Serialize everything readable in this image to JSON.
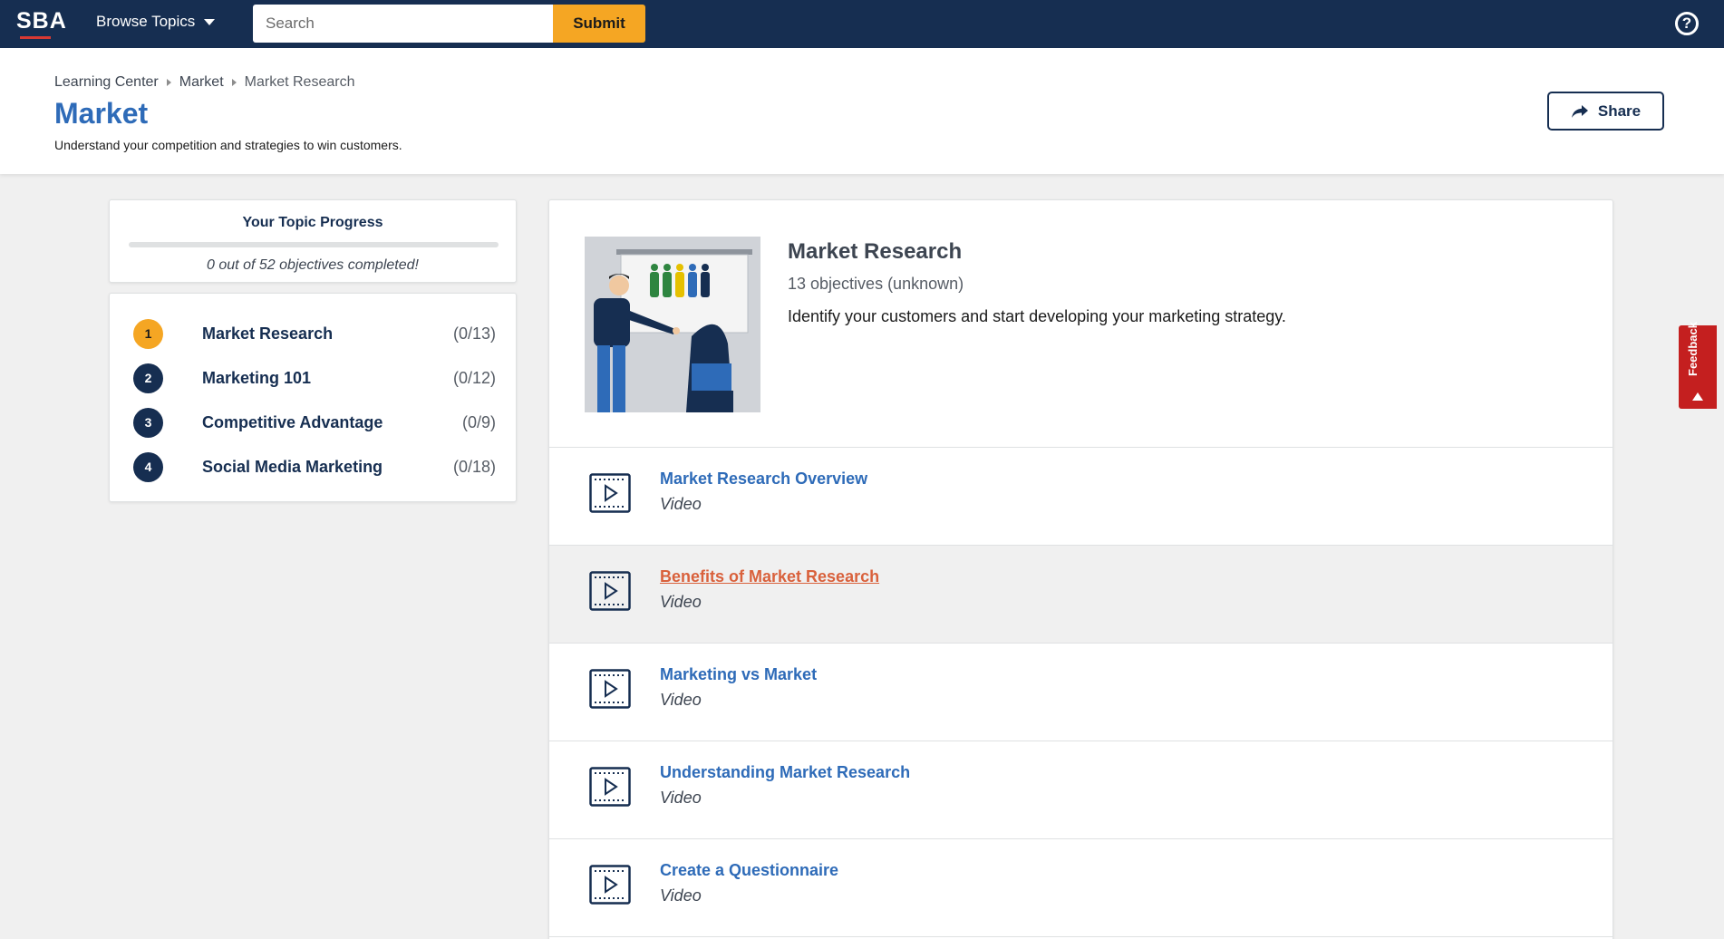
{
  "nav": {
    "logo_text": "SBA",
    "browse_label": "Browse Topics",
    "search_placeholder": "Search",
    "submit_label": "Submit",
    "help_icon_text": "?"
  },
  "breadcrumb": [
    "Learning Center",
    "Market",
    "Market Research"
  ],
  "header": {
    "title": "Market",
    "subtitle": "Understand your competition and strategies to win customers.",
    "share_label": "Share"
  },
  "progress": {
    "title": "Your Topic Progress",
    "text": "0 out of 52 objectives completed!",
    "fraction": 0
  },
  "topics": [
    {
      "num": "1",
      "label": "Market Research",
      "count": "(0/13)",
      "active": true
    },
    {
      "num": "2",
      "label": "Marketing 101",
      "count": "(0/12)",
      "active": false
    },
    {
      "num": "3",
      "label": "Competitive Advantage",
      "count": "(0/9)",
      "active": false
    },
    {
      "num": "4",
      "label": "Social Media Marketing",
      "count": "(0/18)",
      "active": false
    }
  ],
  "intro": {
    "title": "Market Research",
    "count": "13 objectives (unknown)",
    "description": "Identify your customers and start developing your marketing strategy."
  },
  "lessons": [
    {
      "title": "Market Research Overview",
      "type": "Video",
      "hover": false
    },
    {
      "title": "Benefits of Market Research",
      "type": "Video",
      "hover": true
    },
    {
      "title": "Marketing vs Market",
      "type": "Video",
      "hover": false
    },
    {
      "title": "Understanding Market Research",
      "type": "Video",
      "hover": false
    },
    {
      "title": "Create a Questionnaire",
      "type": "Video",
      "hover": false
    }
  ],
  "feedback_label": "Feedback",
  "colors": {
    "nav_bg": "#162e51",
    "accent": "#f5a623",
    "link": "#2e6bb8",
    "link_hover": "#d9613c",
    "feedback": "#c41f1f"
  }
}
